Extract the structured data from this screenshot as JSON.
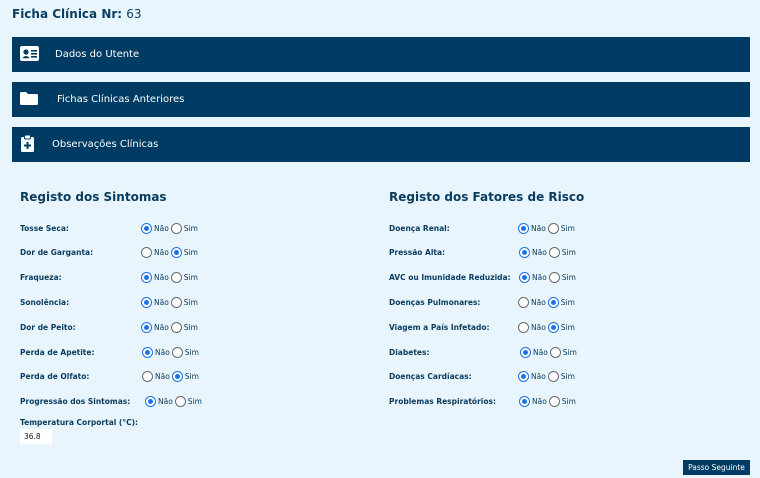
{
  "header": {
    "title": "Ficha Clínica Nr:",
    "number": "63"
  },
  "accordion": [
    {
      "label": "Dados do Utente",
      "icon": "id-card-icon"
    },
    {
      "label": "Fichas Clínicas Anteriores",
      "icon": "folder-icon"
    },
    {
      "label": "Observações Clínicas",
      "icon": "clipboard-plus-icon"
    }
  ],
  "options": {
    "no": "Não",
    "yes": "Sim"
  },
  "symptoms": {
    "title": "Registo dos Sintomas",
    "items": [
      {
        "label": "Tosse Seca:",
        "selected": "no"
      },
      {
        "label": "Dor de Garganta:",
        "selected": "yes"
      },
      {
        "label": "Fraqueza:",
        "selected": "no"
      },
      {
        "label": "Sonolência:",
        "selected": "no"
      },
      {
        "label": "Dor de Peito:",
        "selected": "no"
      },
      {
        "label": "Perda de Apetite:",
        "selected": "no"
      },
      {
        "label": "Perda de Olfato:",
        "selected": "yes"
      },
      {
        "label": "Progressão dos Sintomas:",
        "selected": "no"
      }
    ],
    "temperature_label": "Temperatura Corportal (°C):",
    "temperature_value": "36.8"
  },
  "risk_factors": {
    "title": "Registo dos Fatores de Risco",
    "items": [
      {
        "label": "Doença Renal:",
        "selected": "no"
      },
      {
        "label": "Pressão Alta:",
        "selected": "no"
      },
      {
        "label": "AVC ou Imunidade Reduzida:",
        "selected": "no"
      },
      {
        "label": "Doenças Pulmonares:",
        "selected": "yes"
      },
      {
        "label": "Viagem a País Infetado:",
        "selected": "yes"
      },
      {
        "label": "Diabetes:",
        "selected": "no"
      },
      {
        "label": "Doenças Cardíacas:",
        "selected": "no"
      },
      {
        "label": "Problemas Respiratórios:",
        "selected": "no"
      }
    ]
  },
  "footer": {
    "next_label": "Passo Seguinte"
  },
  "colors": {
    "primary": "#003b63",
    "background": "#e9f5fd",
    "radio_active": "#1a73e8"
  }
}
